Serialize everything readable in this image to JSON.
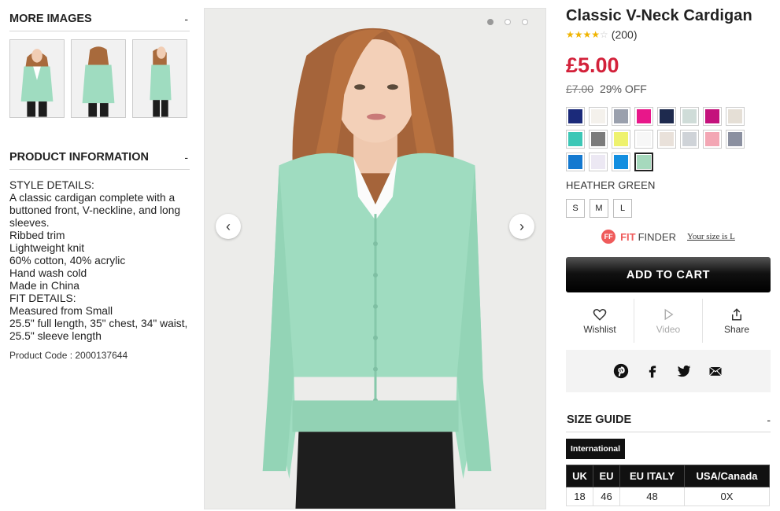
{
  "more_images": {
    "heading": "MORE IMAGES",
    "toggle": "-"
  },
  "product_info": {
    "heading": "PRODUCT INFORMATION",
    "toggle": "-",
    "lines": [
      "STYLE DETAILS:",
      "A classic cardigan complete with a buttoned front, V-neckline, and long sleeves.",
      "Ribbed trim",
      "Lightweight knit",
      "60% cotton, 40% acrylic",
      "Hand wash cold",
      "Made in China",
      "FIT DETAILS:",
      "Measured from Small",
      "25.5\" full length, 35\" chest, 34\" waist, 25.5\" sleeve length"
    ],
    "product_code": "Product Code : 2000137644"
  },
  "gallery": {
    "prev_icon": "chevron-left-icon",
    "next_icon": "chevron-right-icon",
    "prev_glyph": "‹",
    "next_glyph": "›",
    "dot_count": 3,
    "active_dot": 0
  },
  "product": {
    "title": "Classic V-Neck Cardigan",
    "rating": 4,
    "rating_max": 5,
    "review_count": "(200)",
    "price": "£5.00",
    "old_price": "£7.00",
    "discount": "29% OFF",
    "selected_color": "HEATHER GREEN",
    "swatches": [
      "#1b2a7a",
      "#f4f1ec",
      "#9aa0ad",
      "#e8178a",
      "#1e2a4e",
      "#cfdcd8",
      "#c4127c",
      "#e5dfd6",
      "#3cc7b6",
      "#7b7b7b",
      "#eef26e",
      "#f7f7f7",
      "#e9e1da",
      "#cfd3d8",
      "#f3a6b4",
      "#8b90a0",
      "#1479d0",
      "#ece8f3",
      "#128ee0",
      "#a6d9bd"
    ],
    "selected_swatch_index": 19,
    "sizes": [
      "S",
      "M",
      "L"
    ]
  },
  "fit_finder": {
    "logo": "FF",
    "brand": "FIT",
    "label": "FINDER",
    "your_size": "Your size is L"
  },
  "cart": {
    "label": "ADD TO CART"
  },
  "actions": {
    "wishlist": "Wishlist",
    "video": "Video",
    "share": "Share"
  },
  "size_guide": {
    "heading": "SIZE GUIDE",
    "toggle": "-",
    "tab": "International",
    "columns": [
      "UK",
      "EU",
      "EU ITALY",
      "USA/Canada"
    ],
    "rows": [
      [
        "18",
        "46",
        "48",
        "0X"
      ]
    ]
  },
  "colors": {
    "price": "#d3213a",
    "star": "#f0b400",
    "fit_brand": "#ef5b5b",
    "cardigan": "#9fdcc0"
  }
}
